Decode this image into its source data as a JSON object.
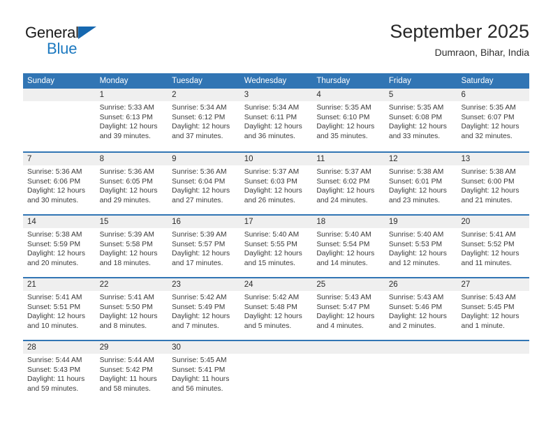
{
  "brand": {
    "name_part1": "General",
    "name_part2": "Blue",
    "color_black": "#1a1a1a",
    "color_blue": "#1c79c0",
    "triangle_color": "#1668b0"
  },
  "header": {
    "month_title": "September 2025",
    "location": "Dumraon, Bihar, India"
  },
  "theme": {
    "header_blue": "#3175b4",
    "day_band_gray": "#efefef",
    "text_dark": "#2b2b2b"
  },
  "weekdays": [
    "Sunday",
    "Monday",
    "Tuesday",
    "Wednesday",
    "Thursday",
    "Friday",
    "Saturday"
  ],
  "weeks": [
    [
      {
        "day": "",
        "sunrise": "",
        "sunset": "",
        "daylight1": "",
        "daylight2": ""
      },
      {
        "day": "1",
        "sunrise": "Sunrise: 5:33 AM",
        "sunset": "Sunset: 6:13 PM",
        "daylight1": "Daylight: 12 hours",
        "daylight2": "and 39 minutes."
      },
      {
        "day": "2",
        "sunrise": "Sunrise: 5:34 AM",
        "sunset": "Sunset: 6:12 PM",
        "daylight1": "Daylight: 12 hours",
        "daylight2": "and 37 minutes."
      },
      {
        "day": "3",
        "sunrise": "Sunrise: 5:34 AM",
        "sunset": "Sunset: 6:11 PM",
        "daylight1": "Daylight: 12 hours",
        "daylight2": "and 36 minutes."
      },
      {
        "day": "4",
        "sunrise": "Sunrise: 5:35 AM",
        "sunset": "Sunset: 6:10 PM",
        "daylight1": "Daylight: 12 hours",
        "daylight2": "and 35 minutes."
      },
      {
        "day": "5",
        "sunrise": "Sunrise: 5:35 AM",
        "sunset": "Sunset: 6:08 PM",
        "daylight1": "Daylight: 12 hours",
        "daylight2": "and 33 minutes."
      },
      {
        "day": "6",
        "sunrise": "Sunrise: 5:35 AM",
        "sunset": "Sunset: 6:07 PM",
        "daylight1": "Daylight: 12 hours",
        "daylight2": "and 32 minutes."
      }
    ],
    [
      {
        "day": "7",
        "sunrise": "Sunrise: 5:36 AM",
        "sunset": "Sunset: 6:06 PM",
        "daylight1": "Daylight: 12 hours",
        "daylight2": "and 30 minutes."
      },
      {
        "day": "8",
        "sunrise": "Sunrise: 5:36 AM",
        "sunset": "Sunset: 6:05 PM",
        "daylight1": "Daylight: 12 hours",
        "daylight2": "and 29 minutes."
      },
      {
        "day": "9",
        "sunrise": "Sunrise: 5:36 AM",
        "sunset": "Sunset: 6:04 PM",
        "daylight1": "Daylight: 12 hours",
        "daylight2": "and 27 minutes."
      },
      {
        "day": "10",
        "sunrise": "Sunrise: 5:37 AM",
        "sunset": "Sunset: 6:03 PM",
        "daylight1": "Daylight: 12 hours",
        "daylight2": "and 26 minutes."
      },
      {
        "day": "11",
        "sunrise": "Sunrise: 5:37 AM",
        "sunset": "Sunset: 6:02 PM",
        "daylight1": "Daylight: 12 hours",
        "daylight2": "and 24 minutes."
      },
      {
        "day": "12",
        "sunrise": "Sunrise: 5:38 AM",
        "sunset": "Sunset: 6:01 PM",
        "daylight1": "Daylight: 12 hours",
        "daylight2": "and 23 minutes."
      },
      {
        "day": "13",
        "sunrise": "Sunrise: 5:38 AM",
        "sunset": "Sunset: 6:00 PM",
        "daylight1": "Daylight: 12 hours",
        "daylight2": "and 21 minutes."
      }
    ],
    [
      {
        "day": "14",
        "sunrise": "Sunrise: 5:38 AM",
        "sunset": "Sunset: 5:59 PM",
        "daylight1": "Daylight: 12 hours",
        "daylight2": "and 20 minutes."
      },
      {
        "day": "15",
        "sunrise": "Sunrise: 5:39 AM",
        "sunset": "Sunset: 5:58 PM",
        "daylight1": "Daylight: 12 hours",
        "daylight2": "and 18 minutes."
      },
      {
        "day": "16",
        "sunrise": "Sunrise: 5:39 AM",
        "sunset": "Sunset: 5:57 PM",
        "daylight1": "Daylight: 12 hours",
        "daylight2": "and 17 minutes."
      },
      {
        "day": "17",
        "sunrise": "Sunrise: 5:40 AM",
        "sunset": "Sunset: 5:55 PM",
        "daylight1": "Daylight: 12 hours",
        "daylight2": "and 15 minutes."
      },
      {
        "day": "18",
        "sunrise": "Sunrise: 5:40 AM",
        "sunset": "Sunset: 5:54 PM",
        "daylight1": "Daylight: 12 hours",
        "daylight2": "and 14 minutes."
      },
      {
        "day": "19",
        "sunrise": "Sunrise: 5:40 AM",
        "sunset": "Sunset: 5:53 PM",
        "daylight1": "Daylight: 12 hours",
        "daylight2": "and 12 minutes."
      },
      {
        "day": "20",
        "sunrise": "Sunrise: 5:41 AM",
        "sunset": "Sunset: 5:52 PM",
        "daylight1": "Daylight: 12 hours",
        "daylight2": "and 11 minutes."
      }
    ],
    [
      {
        "day": "21",
        "sunrise": "Sunrise: 5:41 AM",
        "sunset": "Sunset: 5:51 PM",
        "daylight1": "Daylight: 12 hours",
        "daylight2": "and 10 minutes."
      },
      {
        "day": "22",
        "sunrise": "Sunrise: 5:41 AM",
        "sunset": "Sunset: 5:50 PM",
        "daylight1": "Daylight: 12 hours",
        "daylight2": "and 8 minutes."
      },
      {
        "day": "23",
        "sunrise": "Sunrise: 5:42 AM",
        "sunset": "Sunset: 5:49 PM",
        "daylight1": "Daylight: 12 hours",
        "daylight2": "and 7 minutes."
      },
      {
        "day": "24",
        "sunrise": "Sunrise: 5:42 AM",
        "sunset": "Sunset: 5:48 PM",
        "daylight1": "Daylight: 12 hours",
        "daylight2": "and 5 minutes."
      },
      {
        "day": "25",
        "sunrise": "Sunrise: 5:43 AM",
        "sunset": "Sunset: 5:47 PM",
        "daylight1": "Daylight: 12 hours",
        "daylight2": "and 4 minutes."
      },
      {
        "day": "26",
        "sunrise": "Sunrise: 5:43 AM",
        "sunset": "Sunset: 5:46 PM",
        "daylight1": "Daylight: 12 hours",
        "daylight2": "and 2 minutes."
      },
      {
        "day": "27",
        "sunrise": "Sunrise: 5:43 AM",
        "sunset": "Sunset: 5:45 PM",
        "daylight1": "Daylight: 12 hours",
        "daylight2": "and 1 minute."
      }
    ],
    [
      {
        "day": "28",
        "sunrise": "Sunrise: 5:44 AM",
        "sunset": "Sunset: 5:43 PM",
        "daylight1": "Daylight: 11 hours",
        "daylight2": "and 59 minutes."
      },
      {
        "day": "29",
        "sunrise": "Sunrise: 5:44 AM",
        "sunset": "Sunset: 5:42 PM",
        "daylight1": "Daylight: 11 hours",
        "daylight2": "and 58 minutes."
      },
      {
        "day": "30",
        "sunrise": "Sunrise: 5:45 AM",
        "sunset": "Sunset: 5:41 PM",
        "daylight1": "Daylight: 11 hours",
        "daylight2": "and 56 minutes."
      },
      {
        "day": "",
        "sunrise": "",
        "sunset": "",
        "daylight1": "",
        "daylight2": ""
      },
      {
        "day": "",
        "sunrise": "",
        "sunset": "",
        "daylight1": "",
        "daylight2": ""
      },
      {
        "day": "",
        "sunrise": "",
        "sunset": "",
        "daylight1": "",
        "daylight2": ""
      },
      {
        "day": "",
        "sunrise": "",
        "sunset": "",
        "daylight1": "",
        "daylight2": ""
      }
    ]
  ]
}
